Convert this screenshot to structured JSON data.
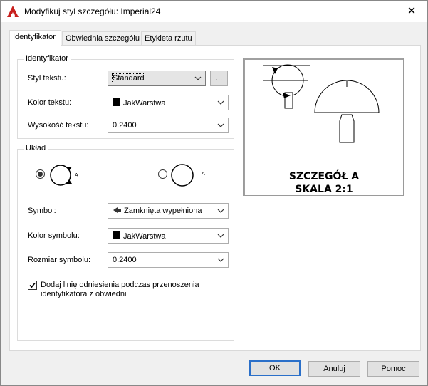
{
  "window": {
    "title": "Modyfikuj styl szczegółu: Imperial24",
    "close_label": "✕"
  },
  "tabs": [
    {
      "label": "Identyfikator",
      "active": true
    },
    {
      "label": "Obwiednia szczegółu",
      "active": false
    },
    {
      "label": "Etykieta rzutu",
      "active": false
    }
  ],
  "identifier_group": {
    "legend": "Identyfikator",
    "text_style_label": "Styl tekstu:",
    "text_style_value": "Standard",
    "browse_label": "...",
    "text_color_label": "Kolor tekstu:",
    "text_color_value": "JakWarstwa",
    "text_height_label": "Wysokość tekstu:",
    "text_height_value": "0.2400"
  },
  "layout_group": {
    "legend": "Układ",
    "option_left_letter": "A",
    "option_right_letter": "A",
    "selected_option": "left",
    "symbol_label": "Symbol:",
    "symbol_value": "Zamknięta wypełniona",
    "symbol_color_label": "Kolor symbolu:",
    "symbol_color_value": "JakWarstwa",
    "symbol_size_label": "Rozmiar symbolu:",
    "symbol_size_value": "0.2400",
    "checkbox_label_line1": "Dodaj linię odniesienia podczas przenoszenia",
    "checkbox_label_line2": "identyfikatora z obwiedni",
    "checkbox_checked": true
  },
  "preview": {
    "caption_line1": "SZCZEGÓŁ A",
    "caption_line2": "SKALA 2:1"
  },
  "buttons": {
    "ok": "OK",
    "cancel": "Anuluj",
    "help": "Pomoc"
  },
  "colors": {
    "app_icon": "#c8201e",
    "default_button_border": "#2a6fc9"
  }
}
